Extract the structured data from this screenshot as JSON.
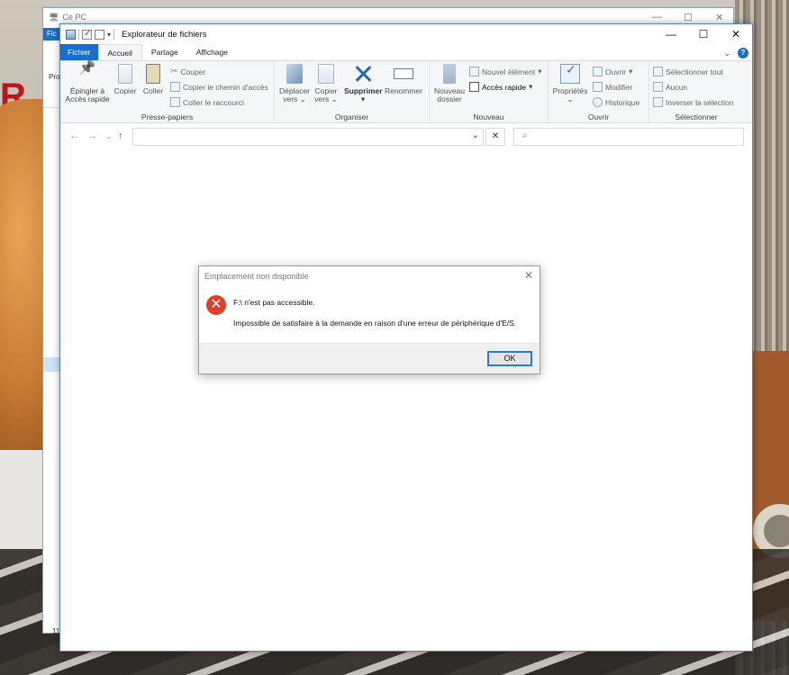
{
  "back_window": {
    "title": "Ce PC",
    "ribbon_tab": "Fic",
    "left_label": "Pro",
    "status_count": "11"
  },
  "window": {
    "title": "Explorateur de fichiers",
    "controls": {
      "minimize": "—",
      "maximize": "☐",
      "close": "✕"
    }
  },
  "tabs": [
    "Fichier",
    "Accueil",
    "Partage",
    "Affichage"
  ],
  "ribbon": {
    "presse_papiers": {
      "label": "Presse-papiers",
      "pin_line1": "Épingler à",
      "pin_line2": "Accès rapide",
      "copy": "Copier",
      "paste": "Coller",
      "cut": "Couper",
      "copy_path": "Copier le chemin d'accès",
      "paste_shortcut": "Coller le raccourci"
    },
    "organiser": {
      "label": "Organiser",
      "move_line1": "Déplacer",
      "move_line2": "vers",
      "copyto_line1": "Copier",
      "copyto_line2": "vers",
      "delete": "Supprimer",
      "rename": "Renommer"
    },
    "nouveau": {
      "label": "Nouveau",
      "new_folder_line1": "Nouveau",
      "new_folder_line2": "dossier",
      "new_item": "Nouvel élément",
      "easy_access": "Accès rapide"
    },
    "ouvrir": {
      "label": "Ouvrir",
      "properties": "Propriétés",
      "open": "Ouvrir",
      "edit": "Modifier",
      "history": "Historique"
    },
    "selectionner": {
      "label": "Sélectionner",
      "select_all": "Sélectionner tout",
      "select_none": "Aucun",
      "invert": "Inverser la sélection"
    }
  },
  "navbar": {
    "back": "←",
    "forward": "→",
    "recent": "⌄",
    "up": "↑",
    "address_value": "",
    "search_placeholder": ""
  },
  "dialog": {
    "title": "Emplacement non disponible",
    "message_line1": "F:\\ n'est pas accessible.",
    "message_line2": "Impossible de satisfaire à la demande en raison d'une erreur de périphérique d'E/S.",
    "ok_label": "OK",
    "error_glyph": "✕",
    "close_glyph": "✕"
  },
  "colors": {
    "file_tab": "#1a6ec7",
    "error_icon": "#e0402a",
    "ok_border": "#2b79d6"
  }
}
